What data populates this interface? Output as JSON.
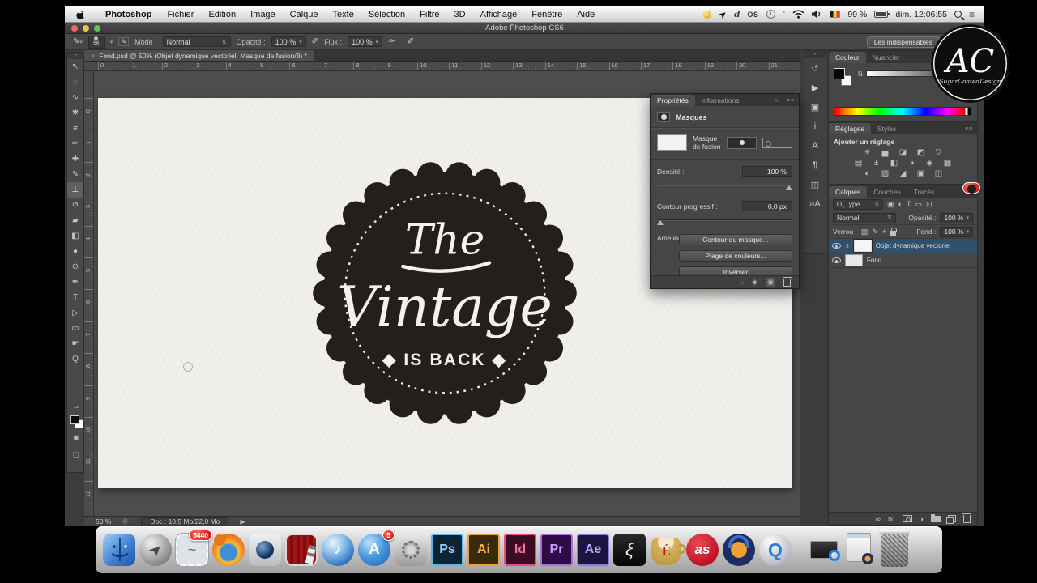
{
  "menu_bar": {
    "app_name": "Photoshop",
    "menus": [
      "Fichier",
      "Edition",
      "Image",
      "Calque",
      "Texte",
      "Sélection",
      "Filtre",
      "3D",
      "Affichage",
      "Fenêtre",
      "Aide"
    ],
    "extras_d": "d",
    "extras_os": "OS",
    "battery_percent": "99 %",
    "clock": "dim. 12:06:55"
  },
  "window": {
    "title": "Adobe Photoshop CS6"
  },
  "options_bar": {
    "brush_size": "66",
    "mode_label": "Mode :",
    "mode_value": "Normal",
    "opacity_label": "Opacité :",
    "opacity_value": "100 %",
    "flow_label": "Flux :",
    "flow_value": "100 %",
    "workspace_button": "Les indispensables"
  },
  "document": {
    "tab_title": "Fond.psd @ 50% (Objet dynamique vectoriel, Masque de fusion/8) *",
    "close_glyph": "×",
    "zoom_level": "50 %",
    "doc_size": "Doc : 10,5 Mo/22,0 Mo",
    "ruler_h": [
      "0",
      "1",
      "2",
      "3",
      "4",
      "5",
      "6",
      "7",
      "8",
      "9",
      "10",
      "11",
      "12",
      "13",
      "14",
      "15",
      "16",
      "17",
      "18",
      "19",
      "20",
      "21"
    ],
    "ruler_v": [
      "0",
      "1",
      "2",
      "3",
      "4",
      "5",
      "6",
      "7",
      "8",
      "9",
      "10",
      "11",
      "12"
    ]
  },
  "toolbar": {
    "tools": [
      {
        "name": "move-tool-icon",
        "glyph": "↖"
      },
      {
        "name": "elliptical-marquee-tool-icon",
        "glyph": "◌"
      },
      {
        "name": "lasso-tool-icon",
        "glyph": "∿"
      },
      {
        "name": "quick-selection-tool-icon",
        "glyph": "✱"
      },
      {
        "name": "crop-tool-icon",
        "glyph": "#"
      },
      {
        "name": "eyedropper-tool-icon",
        "glyph": "✑"
      },
      {
        "name": "healing-brush-tool-icon",
        "glyph": "✚"
      },
      {
        "name": "brush-tool-icon",
        "glyph": "✎"
      },
      {
        "name": "clone-stamp-tool-icon",
        "glyph": "⊥"
      },
      {
        "name": "history-brush-tool-icon",
        "glyph": "↺"
      },
      {
        "name": "eraser-tool-icon",
        "glyph": "▰"
      },
      {
        "name": "gradient-tool-icon",
        "glyph": "◧"
      },
      {
        "name": "blur-tool-icon",
        "glyph": "●"
      },
      {
        "name": "dodge-tool-icon",
        "glyph": "⊙"
      },
      {
        "name": "pen-tool-icon",
        "glyph": "✒"
      },
      {
        "name": "type-tool-icon",
        "glyph": "T"
      },
      {
        "name": "path-selection-tool-icon",
        "glyph": "▷"
      },
      {
        "name": "rectangle-tool-icon",
        "glyph": "▭"
      },
      {
        "name": "hand-tool-icon",
        "glyph": "☛"
      },
      {
        "name": "zoom-tool-icon",
        "glyph": "Q"
      }
    ]
  },
  "canvas": {
    "badge": {
      "line1": "The",
      "line2": "Vintage",
      "line3": "◆ IS BACK ◆"
    }
  },
  "properties_panel": {
    "tab_active": "Propriétés",
    "tab_inactive": "Informations",
    "header": "Masques",
    "mask_row_label": "Masque de fusion",
    "density_label": "Densité :",
    "density_value": "100 %",
    "feather_label": "Contour progressif :",
    "feather_value": "0,0 px",
    "refine_label": "Améliorer :",
    "btn_mask_edge": "Contour du masque...",
    "btn_color_range": "Plage de couleurs...",
    "btn_invert": "Inverser"
  },
  "dock_strip": {
    "icons": [
      {
        "name": "history-panel-icon",
        "glyph": "↺"
      },
      {
        "name": "actions-panel-icon",
        "glyph": "▶"
      },
      {
        "name": "properties-panel-icon",
        "glyph": "▣"
      },
      {
        "name": "info-panel-icon",
        "glyph": "i"
      },
      {
        "name": "character-panel-icon",
        "glyph": "A"
      },
      {
        "name": "paragraph-panel-icon",
        "glyph": "¶"
      },
      {
        "name": "layer-comps-panel-icon",
        "glyph": "◫"
      },
      {
        "name": "glyphs-panel-icon",
        "glyph": "aA"
      }
    ]
  },
  "color_panel": {
    "tab_active": "Couleur",
    "tab_inactive": "Nuancier",
    "channel_label": "N"
  },
  "adjustments_panel": {
    "tab_active": "Réglages",
    "tab_inactive": "Styles",
    "header": "Ajouter un réglage",
    "row1": [
      {
        "name": "brightness-contrast-icon",
        "glyph": "☀"
      },
      {
        "name": "levels-icon",
        "glyph": "▅"
      },
      {
        "name": "curves-icon",
        "glyph": "◪"
      },
      {
        "name": "exposure-icon",
        "glyph": "◩"
      },
      {
        "name": "vibrance-icon",
        "glyph": "▽"
      }
    ],
    "row2": [
      {
        "name": "hue-saturation-icon",
        "glyph": "▤"
      },
      {
        "name": "color-balance-icon",
        "glyph": "±"
      },
      {
        "name": "black-white-icon",
        "glyph": "◧"
      },
      {
        "name": "photo-filter-icon",
        "glyph": "◑"
      },
      {
        "name": "channel-mixer-icon",
        "glyph": "◈"
      },
      {
        "name": "color-lookup-icon",
        "glyph": "▦"
      }
    ],
    "row3": [
      {
        "name": "invert-icon",
        "glyph": "◐"
      },
      {
        "name": "posterize-icon",
        "glyph": "▨"
      },
      {
        "name": "threshold-icon",
        "glyph": "◢"
      },
      {
        "name": "selective-color-icon",
        "glyph": "▣"
      },
      {
        "name": "gradient-map-icon",
        "glyph": "◫"
      }
    ]
  },
  "layers_panel": {
    "tab_1": "Calques",
    "tab_2": "Couches",
    "tab_3": "Tracés",
    "filter_value": "Type",
    "blend_mode": "Normal",
    "opacity_label": "Opacité :",
    "opacity_value": "100 %",
    "lock_label": "Verrou :",
    "fill_label": "Fond :",
    "fill_value": "100 %",
    "layers": [
      {
        "name": "Objet dynamique vectoriel"
      },
      {
        "name": "Fond"
      }
    ],
    "fx_label": "fx."
  },
  "watermark": {
    "initials": "AC",
    "studio": "SugarCoatedDesign"
  },
  "dock": {
    "mail_badge": "5440",
    "appstore_badge": "5",
    "photoshop_label": "Ps",
    "illustrator_label": "Ai",
    "indesign_label": "Id",
    "premiere_label": "Pr",
    "aftereffects_label": "Ae",
    "coffee_label": "É",
    "lastfm_label": "as",
    "itunes_glyph": "♪",
    "quicktime_label": "Q",
    "dragon_glyph": "ξ"
  }
}
